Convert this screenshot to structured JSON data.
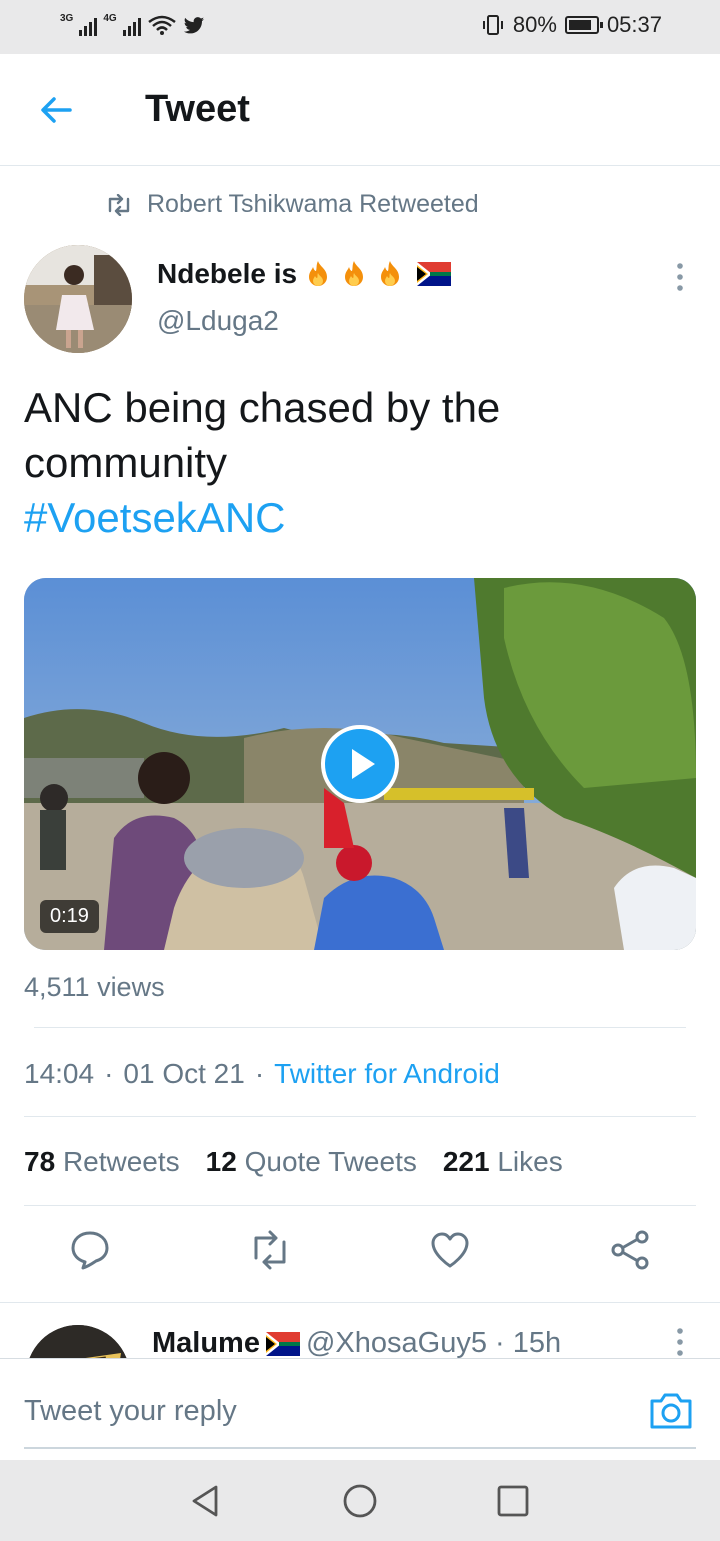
{
  "status_bar": {
    "network_1": "3G",
    "network_2": "4G",
    "battery": "80%",
    "time": "05:37",
    "icons": [
      "signal-icon",
      "wifi-icon",
      "twitter-bird-icon",
      "vibrate-icon",
      "battery-icon"
    ]
  },
  "header": {
    "title": "Tweet",
    "back_icon": "back-arrow-icon"
  },
  "retweet": {
    "label": "Robert Tshikwama Retweeted"
  },
  "author": {
    "name": "Ndebele is",
    "emojis": [
      "fire",
      "fire",
      "fire",
      "south-africa-flag"
    ],
    "handle": "@Lduga2"
  },
  "tweet": {
    "text": "ANC being chased by the community",
    "hashtag": "#VoetsekANC"
  },
  "media": {
    "duration": "0:19",
    "type": "video"
  },
  "views": "4,511 views",
  "meta": {
    "time": "14:04",
    "dot1": "·",
    "date": "01 Oct 21",
    "dot2": "·",
    "source": "Twitter for Android"
  },
  "stats": {
    "retweets_count": "78",
    "retweets_label": "Retweets",
    "quotes_count": "12",
    "quotes_label": "Quote Tweets",
    "likes_count": "221",
    "likes_label": "Likes"
  },
  "actions": [
    "reply-icon",
    "retweet-icon",
    "like-icon",
    "share-icon"
  ],
  "reply_preview": {
    "name": "Malume",
    "handle": "@XhosaGuy5 · 15h"
  },
  "composer": {
    "placeholder": "Tweet your reply"
  },
  "colors": {
    "accent": "#1da1f2",
    "muted": "#657786",
    "text": "#14171a"
  }
}
